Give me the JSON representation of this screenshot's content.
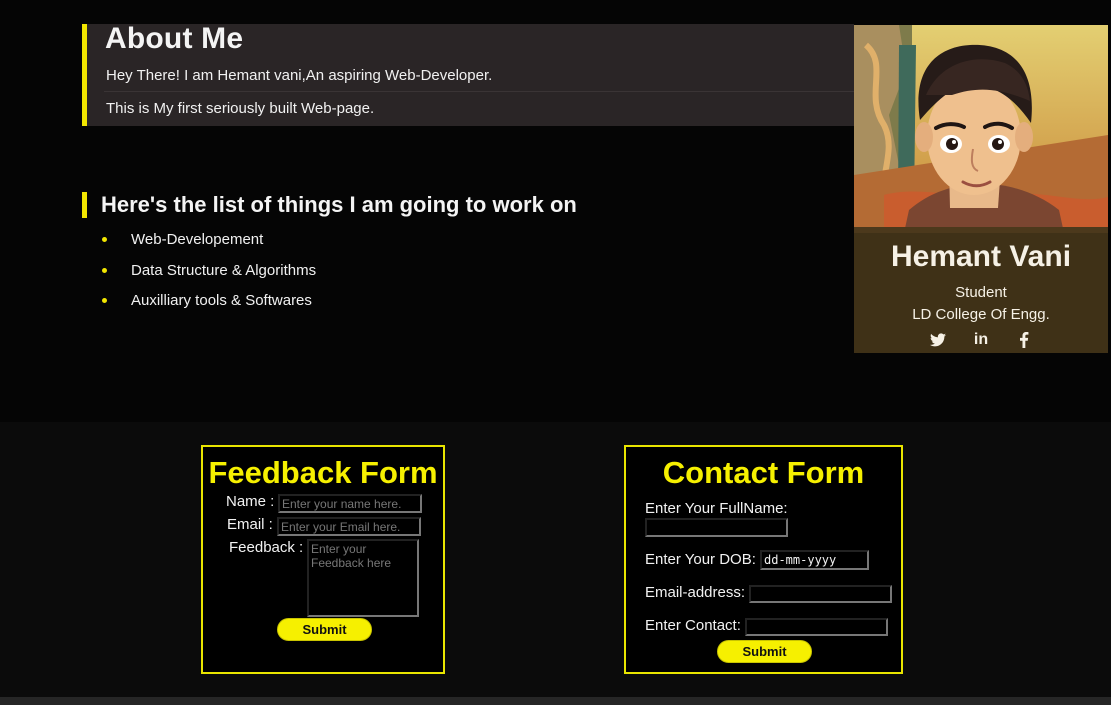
{
  "about": {
    "title": "About Me",
    "lines": [
      "Hey There! I am Hemant vani,An aspiring Web-Developer.",
      "This is My first seriously built Web-page."
    ]
  },
  "work_list": {
    "heading": "Here's the list of things I am going to work on",
    "items": [
      "Web-Developement",
      "Data Structure & Algorithms",
      "Auxilliary tools & Softwares"
    ]
  },
  "profile": {
    "name": "Hemant Vani",
    "role": "Student",
    "college": "LD College Of Engg.",
    "social_icons": [
      "twitter-icon",
      "linkedin-icon",
      "facebook-icon"
    ],
    "social_labels": [
      "in"
    ]
  },
  "feedback_form": {
    "title": "Feedback Form",
    "name_label": "Name :",
    "name_placeholder": "Enter your name here.",
    "email_label": "Email :",
    "email_placeholder": "Enter your Email here.",
    "feedback_label": "Feedback :",
    "feedback_placeholder": "Enter your Feedback here",
    "submit_label": "Submit"
  },
  "contact_form": {
    "title": "Contact Form",
    "fullname_label": "Enter Your FullName:",
    "fullname_value": "",
    "dob_label": "Enter Your DOB:",
    "dob_value": "dd-mm-yyyy",
    "email_label": "Email-address:",
    "email_value": "",
    "contact_label": "Enter Contact:",
    "contact_value": "",
    "submit_label": "Submit"
  },
  "colors": {
    "accent": "#f6f000",
    "background": "#060606",
    "panel": "#2a2526",
    "profile_card": "#3f3117"
  }
}
